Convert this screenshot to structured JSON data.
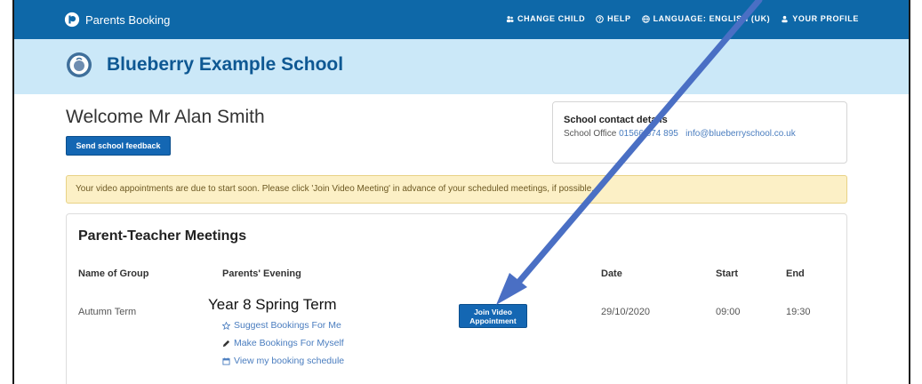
{
  "topbar": {
    "brand": "Parents Booking",
    "nav": [
      {
        "label": "CHANGE CHILD",
        "icon": "users-icon"
      },
      {
        "label": "HELP",
        "icon": "help-icon"
      },
      {
        "label": "LANGUAGE: ENGLISH (UK)",
        "icon": "globe-icon"
      },
      {
        "label": "YOUR PROFILE",
        "icon": "user-icon"
      }
    ]
  },
  "school": {
    "name": "Blueberry Example School"
  },
  "welcome": {
    "text": "Welcome Mr Alan Smith",
    "feedback_label": "Send school feedback"
  },
  "contact": {
    "title": "School contact details",
    "label": "School Office",
    "phone": "01566 674 895",
    "email": "info@blueberryschool.co.uk"
  },
  "notice": {
    "text": "Your video appointments are due to start soon. Please click 'Join Video Meeting' in advance of your scheduled meetings, if possible."
  },
  "meetings": {
    "title": "Parent-Teacher Meetings",
    "columns": [
      "Name of Group",
      "Parents' Evening",
      "Date",
      "Start",
      "End"
    ],
    "row": {
      "group": "Autumn Term",
      "evening": "Year 8 Spring Term",
      "links": [
        "Suggest Bookings For Me",
        "Make Bookings For Myself",
        "View my booking schedule"
      ],
      "join_label_1": "Join Video",
      "join_label_2": "Appointment",
      "date": "29/10/2020",
      "start": "09:00",
      "end": "19:30"
    }
  },
  "colors": {
    "header": "#0e68a8",
    "band": "#cbe8f8",
    "button": "#1467b3",
    "arrow": "#4a6fc4",
    "notice": "#fcf0c6"
  }
}
